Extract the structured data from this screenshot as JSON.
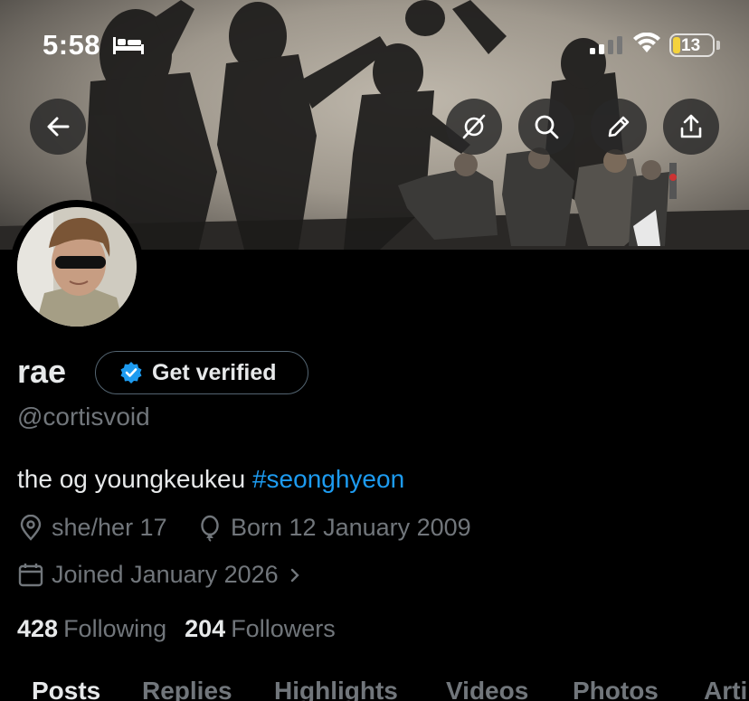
{
  "status_bar": {
    "time": "5:58",
    "battery": "13"
  },
  "profile": {
    "name": "rae",
    "handle": "@cortisvoid",
    "verify_button": "Get verified",
    "bio_text": "the og youngkeukeu ",
    "bio_hashtag": "#seonghyeon",
    "location": "she/her 17",
    "birthday": "Born 12 January 2009",
    "joined": "Joined January 2026",
    "following_count": "428",
    "following_label": "Following",
    "followers_count": "204",
    "followers_label": "Followers"
  },
  "tabs": [
    "Posts",
    "Replies",
    "Highlights",
    "Videos",
    "Photos",
    "Arti"
  ],
  "icons": {
    "back": "arrow-left-icon",
    "grok": "grok-icon",
    "search": "search-icon",
    "edit": "pencil-icon",
    "share": "share-icon"
  },
  "colors": {
    "accent": "#1d9bf0",
    "muted": "#71767b",
    "text": "#e7e9ea",
    "battery_low": "#f4d23c"
  }
}
